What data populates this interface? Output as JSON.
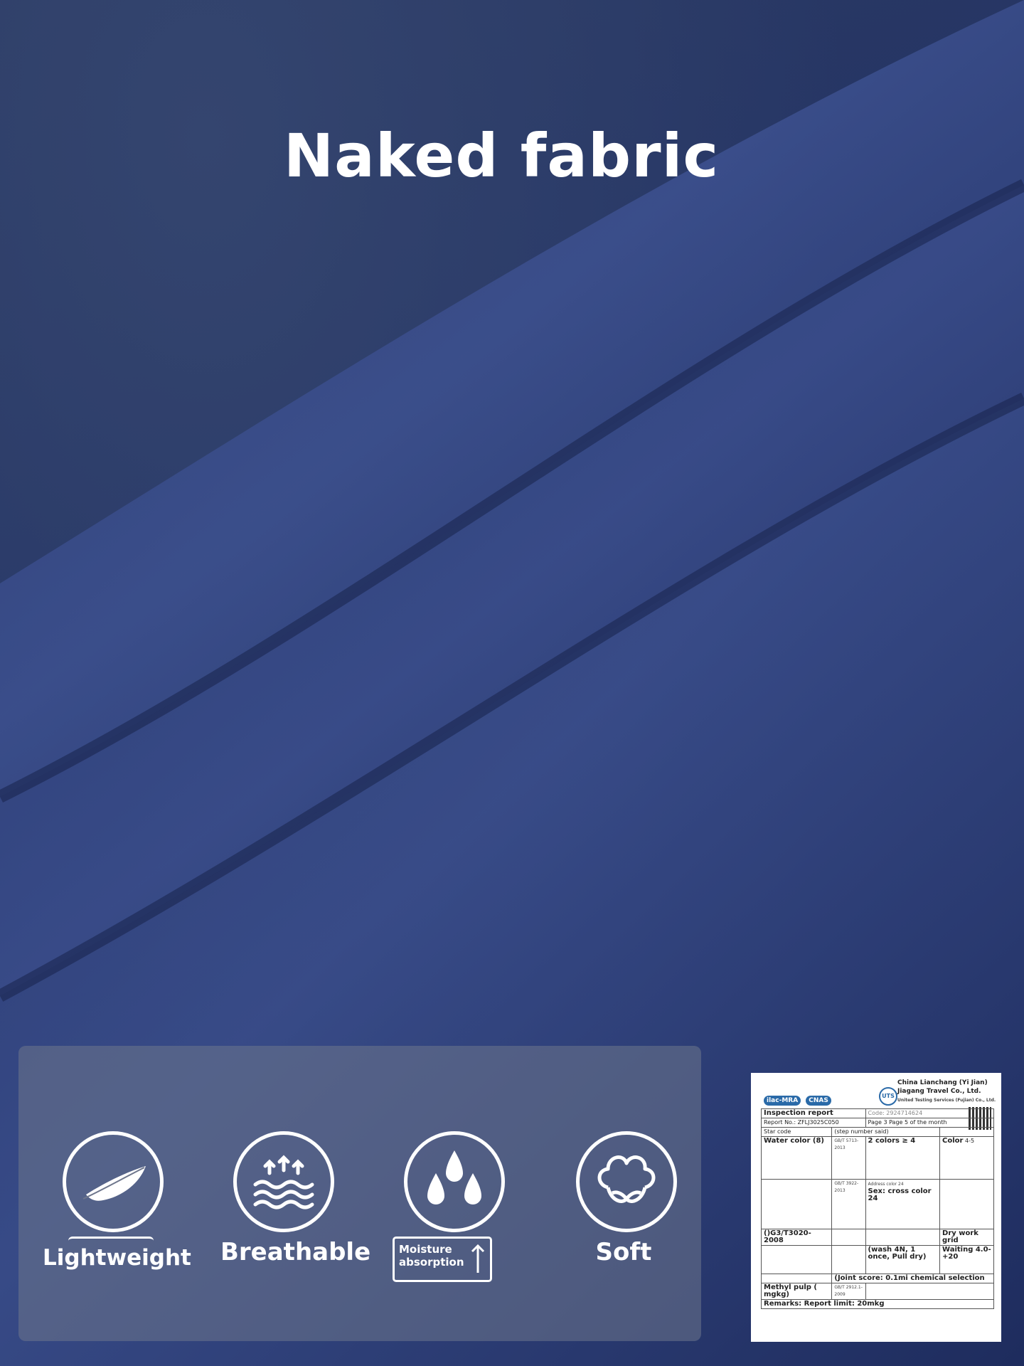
{
  "hero": {
    "title": "Naked fabric"
  },
  "colors": {
    "background": "#1f2d5c",
    "fold_light": "#3c4f8a",
    "panel": "#6e768c"
  },
  "features": [
    {
      "label": "Lightweight",
      "icon": "feather-icon"
    },
    {
      "label": "Breathable",
      "icon": "airflow-waves-icon"
    },
    {
      "label": "Moisture absorption",
      "label_line1": "Moisture",
      "label_line2": "absorption",
      "icon": "water-drops-icon"
    },
    {
      "label": "Soft",
      "icon": "cotton-boll-icon"
    }
  ],
  "report": {
    "lab_name_line1": "China Lianchang (Yi Jian)",
    "lab_name_line2": "Jiagang Travel Co., Ltd.",
    "lab_sub": "United Testing Services (Fujian) Co., Ltd.",
    "logo1": "ilac-MRA",
    "logo2": "CNAS",
    "uts": "UTS",
    "title": "Inspection report",
    "code": "Code: 2924714624",
    "report_no": "Report No.: ZFLJ3025C050",
    "page": "Page 3 Page 5 of the",
    "page2": "month",
    "col_star": "Star code",
    "col_step": "(step number said)",
    "row1_item": "Water color (8)",
    "row1_std": "GB/T 5713-2013",
    "row1_req": "2 colors ≥ 4",
    "row1_res": "Color",
    "row2_std": "GB/T 3922-2013",
    "row2_req_a": "Address color 24",
    "row2_req_b": "Sex: cross color 24",
    "row3_item": "()G3/T3020-2008",
    "row3_res": "Dry work grid",
    "row4_req": "(wash 4N, 1 once, Pull dry)",
    "row4_res": "Waiting 4.0-+20",
    "row5_req": "(Joint score: 0.1mi chemical selection",
    "row6_item": "Methyl pulp ( mgkg)",
    "row6_std": "GB/T 2912.1-2009",
    "remarks": "Remarks: Report limit: 20mkg",
    "grade": "4-5"
  }
}
